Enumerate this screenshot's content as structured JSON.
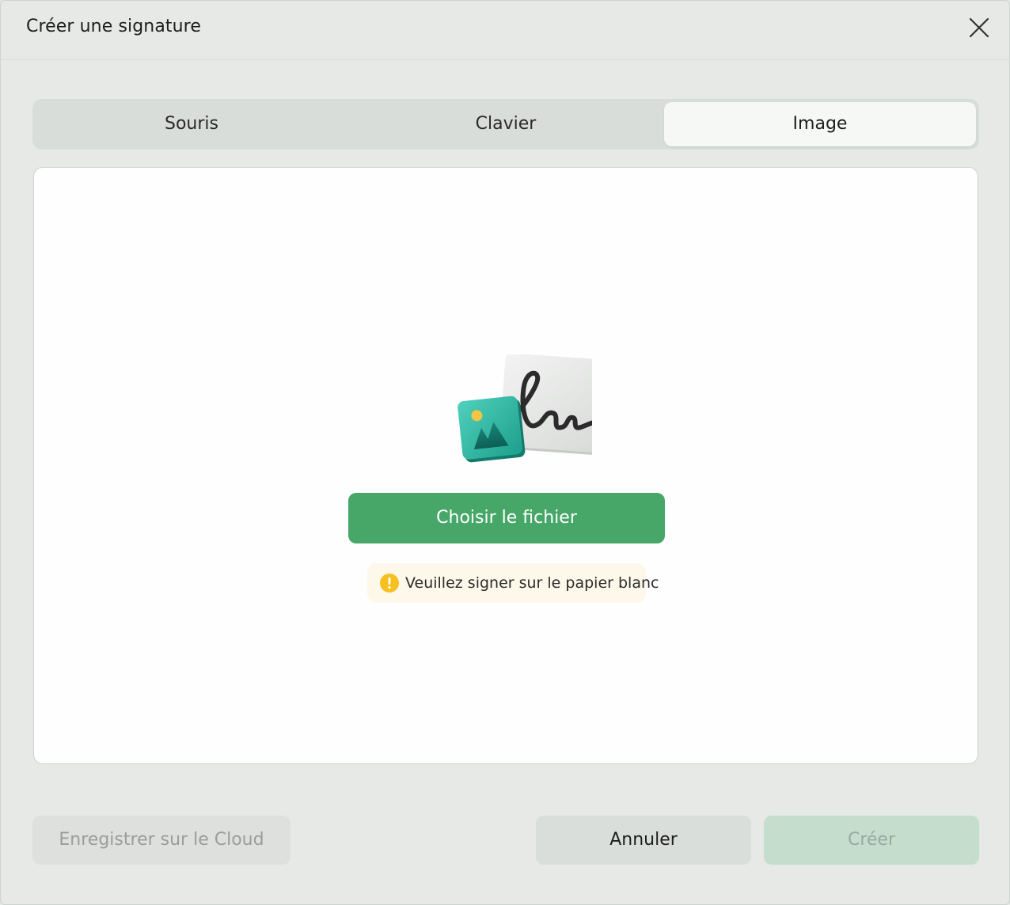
{
  "dialog": {
    "title": "Créer une signature",
    "close_icon": "close-icon"
  },
  "tabs": [
    {
      "label": "Souris",
      "selected": false
    },
    {
      "label": "Clavier",
      "selected": false
    },
    {
      "label": "Image",
      "selected": true
    }
  ],
  "image_panel": {
    "illustration_icon": "signature-image-illustration",
    "choose_file_label": "Choisir le fichier",
    "hint_icon": "warning-icon",
    "hint_text": "Veuillez signer sur le papier blanc"
  },
  "footer": {
    "cloud_label": "Enregistrer sur le Cloud",
    "cancel_label": "Annuler",
    "create_label": "Créer"
  },
  "colors": {
    "accent": "#47a769",
    "warning": "#f5c020",
    "create_disabled": "#c5ddcc"
  }
}
